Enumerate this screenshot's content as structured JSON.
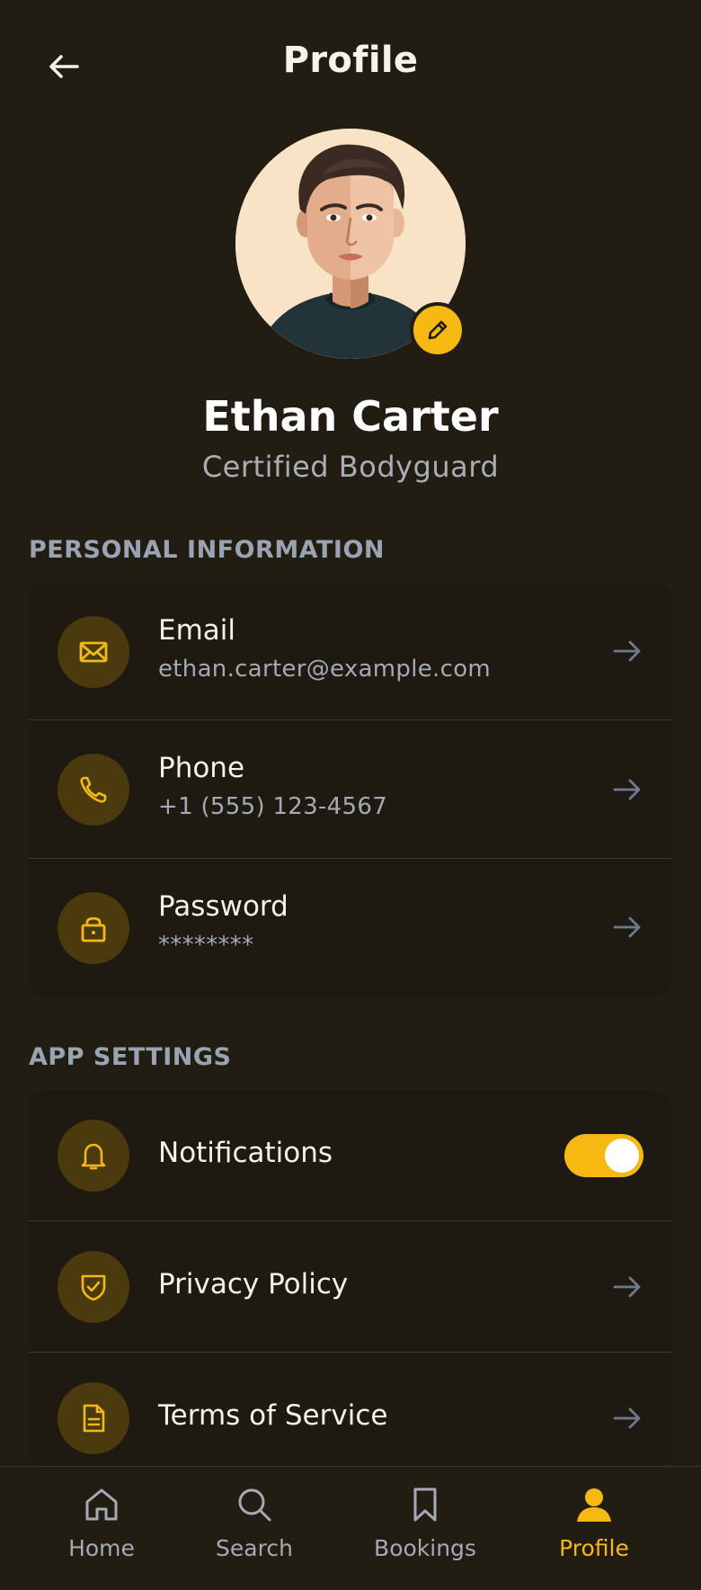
{
  "header": {
    "title": "Profile",
    "back_icon": "arrow-left-icon"
  },
  "profile": {
    "name": "Ethan Carter",
    "role": "Certified Bodyguard",
    "avatar_icon": "avatar-portrait",
    "edit_icon": "pencil-icon"
  },
  "personal_info": {
    "title": "PERSONAL INFORMATION",
    "items": [
      {
        "label": "Email",
        "value": "ethan.carter@example.com",
        "icon": "mail-icon"
      },
      {
        "label": "Phone",
        "value": "+1 (555) 123-4567",
        "icon": "phone-icon"
      },
      {
        "label": "Password",
        "value": "********",
        "icon": "lock-icon"
      }
    ]
  },
  "app_settings": {
    "title": "APP SETTINGS",
    "items": [
      {
        "label": "Notifications",
        "icon": "bell-icon",
        "toggle_on": true
      },
      {
        "label": "Privacy Policy",
        "icon": "shield-check-icon"
      },
      {
        "label": "Terms of Service",
        "icon": "document-icon"
      }
    ]
  },
  "nav": {
    "items": [
      {
        "label": "Home",
        "icon": "home-icon"
      },
      {
        "label": "Search",
        "icon": "search-icon"
      },
      {
        "label": "Bookings",
        "icon": "bookmark-icon"
      },
      {
        "label": "Profile",
        "icon": "user-icon",
        "active": true
      }
    ]
  },
  "colors": {
    "background": "#221d12",
    "card": "#1f1a11",
    "accent": "#f5b912",
    "icon_circle": "#4a3a0d",
    "muted_text": "#a4aab5"
  }
}
